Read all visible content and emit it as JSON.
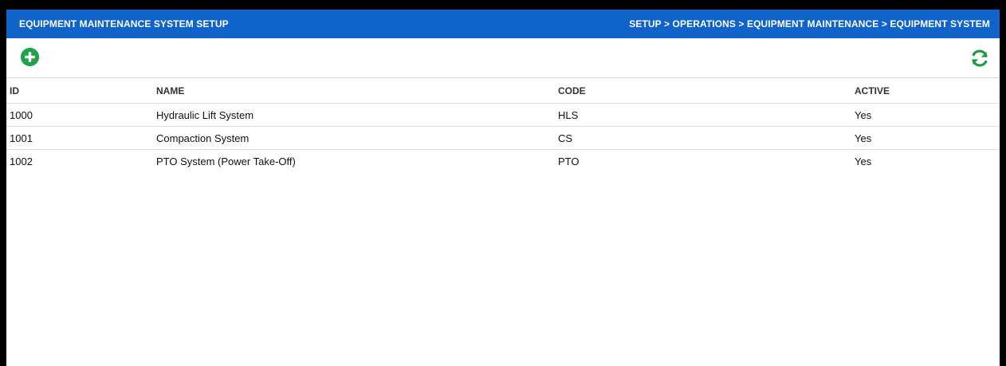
{
  "header": {
    "title": "EQUIPMENT MAINTENANCE SYSTEM SETUP",
    "breadcrumb": "SETUP > OPERATIONS > EQUIPMENT MAINTENANCE > EQUIPMENT SYSTEM"
  },
  "toolbar": {
    "add_icon": "plus-circle-icon",
    "refresh_icon": "refresh-icon"
  },
  "colors": {
    "header_bg": "#0f63c9",
    "add_green": "#20a14a",
    "refresh_green": "#1f9a3e"
  },
  "table": {
    "columns": [
      "ID",
      "NAME",
      "CODE",
      "ACTIVE"
    ],
    "rows": [
      {
        "id": "1000",
        "name": "Hydraulic Lift System",
        "code": "HLS",
        "active": "Yes"
      },
      {
        "id": "1001",
        "name": "Compaction System",
        "code": "CS",
        "active": "Yes"
      },
      {
        "id": "1002",
        "name": "PTO System (Power Take-Off)",
        "code": "PTO",
        "active": "Yes"
      }
    ]
  }
}
